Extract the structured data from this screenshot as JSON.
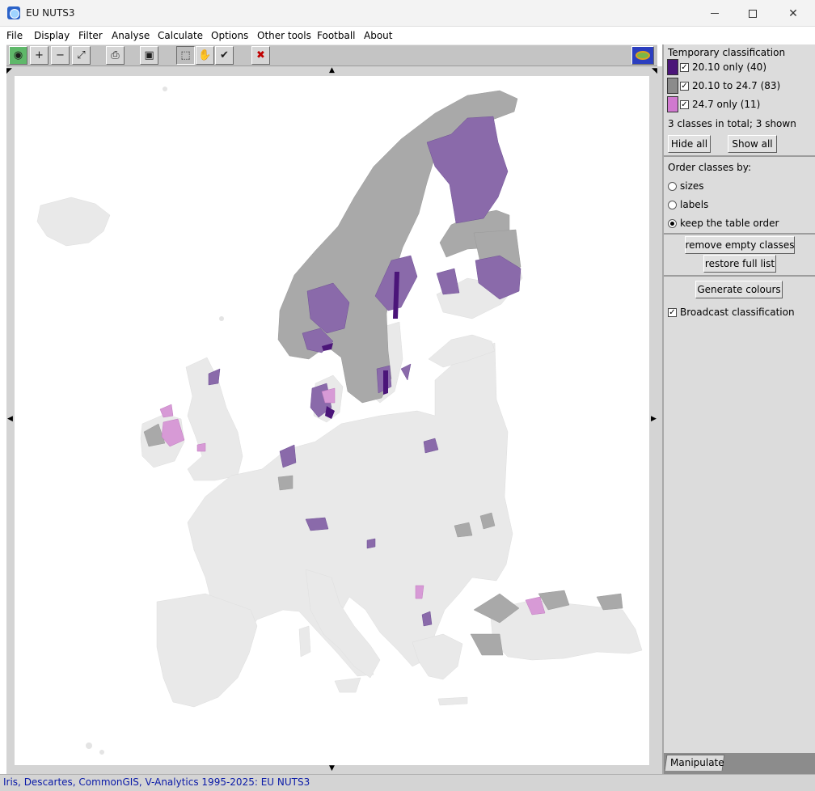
{
  "window": {
    "title": "EU NUTS3"
  },
  "menu": [
    "File",
    "Display",
    "Filter",
    "Analyse",
    "Calculate",
    "Options",
    "Other tools",
    "Football",
    "About"
  ],
  "toolbar": {
    "tools": [
      {
        "icon": "globe-icon",
        "glyph": "◉"
      },
      {
        "icon": "zoom-in-icon",
        "glyph": "+"
      },
      {
        "icon": "zoom-out-icon",
        "glyph": "−"
      },
      {
        "icon": "zoom-fit-icon",
        "glyph": "⤢"
      },
      {
        "icon": "print-icon",
        "glyph": "⎙"
      },
      {
        "icon": "save-icon",
        "glyph": "▣"
      },
      {
        "icon": "select-icon",
        "glyph": "⬚"
      },
      {
        "icon": "pan-hand-icon",
        "glyph": "✋"
      },
      {
        "icon": "check-icon",
        "glyph": "✔"
      },
      {
        "icon": "clear-selection-icon",
        "glyph": "✖"
      }
    ]
  },
  "panel": {
    "heading": "Temporary classification",
    "classes": [
      {
        "label": "20.10 only (40)",
        "color": "#4b1579",
        "checked": true
      },
      {
        "label": "20.10 to 24.7 (83)",
        "color": "#8b8b8b",
        "checked": true
      },
      {
        "label": "24.7 only (11)",
        "color": "#d079cf",
        "checked": true
      }
    ],
    "summary": "3 classes in total; 3 shown",
    "hide_all": "Hide all",
    "show_all": "Show all",
    "order_heading": "Order classes by:",
    "order_options": [
      "sizes",
      "labels",
      "keep the table order"
    ],
    "order_selected": "keep the table order",
    "remove_empty": "remove empty classes",
    "restore_full": "restore full list",
    "generate_colours": "Generate colours",
    "broadcast": "Broadcast classification",
    "broadcast_checked": true,
    "tab": "Manipulate"
  },
  "map_colors": {
    "background": "#e9e9e9",
    "class_20_10_only": "#8a6aaa",
    "class_20_10_only_dark": "#4b1579",
    "class_20_10_to_24_7": "#a9a9a9",
    "class_24_7_only": "#d79ad6"
  },
  "status": "Iris, Descartes, CommonGIS, V-Analytics 1995-2025: EU NUTS3"
}
